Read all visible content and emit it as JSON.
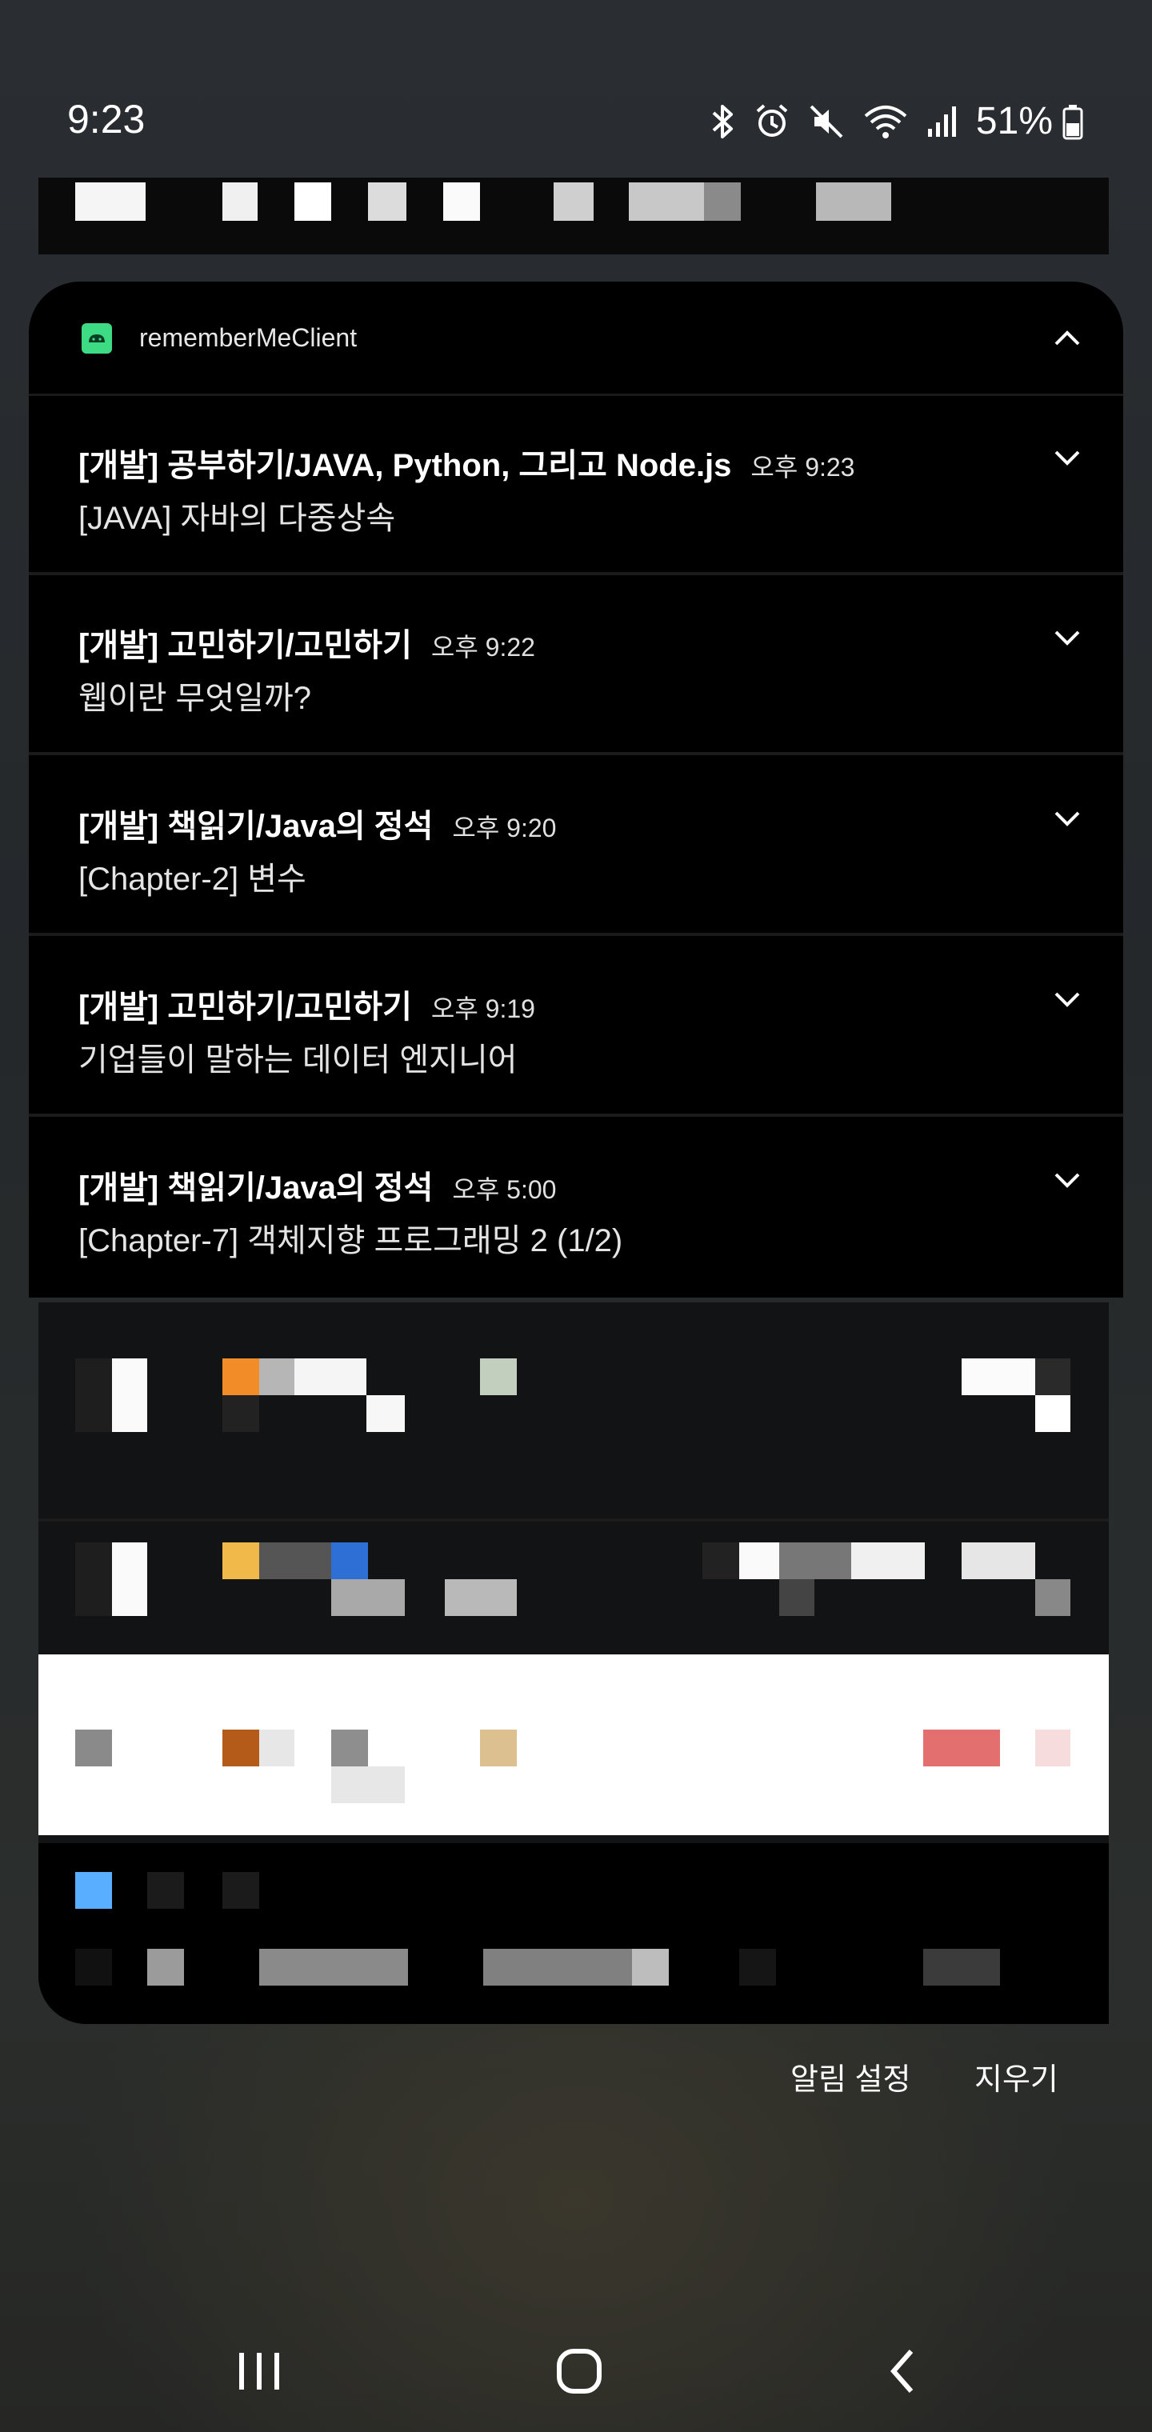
{
  "status_bar": {
    "time": "9:23",
    "battery_percent": "51%",
    "icons": [
      "bluetooth-icon",
      "alarm-icon",
      "mute-icon",
      "wifi-icon",
      "signal-icon",
      "battery-icon"
    ]
  },
  "notification_group": {
    "app_name": "rememberMeClient",
    "app_icon": "android-icon",
    "accent_color": "#3ddc84",
    "notifications": [
      {
        "title": "[개발] 공부하기/JAVA, Python, 그리고 Node.js",
        "time": "오후 9:23",
        "text": "[JAVA] 자바의 다중상속"
      },
      {
        "title": "[개발] 고민하기/고민하기",
        "time": "오후 9:22",
        "text": "웹이란 무엇일까?"
      },
      {
        "title": "[개발] 책읽기/Java의 정석",
        "time": "오후 9:20",
        "text": "[Chapter-2] 변수"
      },
      {
        "title": "[개발] 고민하기/고민하기",
        "time": "오후 9:19",
        "text": "기업들이 말하는 데이터 엔지니어"
      },
      {
        "title": "[개발] 책읽기/Java의 정석",
        "time": "오후 5:00",
        "text": "[Chapter-7] 객체지향 프로그래밍 2 (1/2)"
      }
    ]
  },
  "footer": {
    "settings_label": "알림 설정",
    "clear_label": "지우기"
  },
  "nav_bar": {
    "buttons": [
      "recents-icon",
      "home-icon",
      "back-icon"
    ]
  }
}
